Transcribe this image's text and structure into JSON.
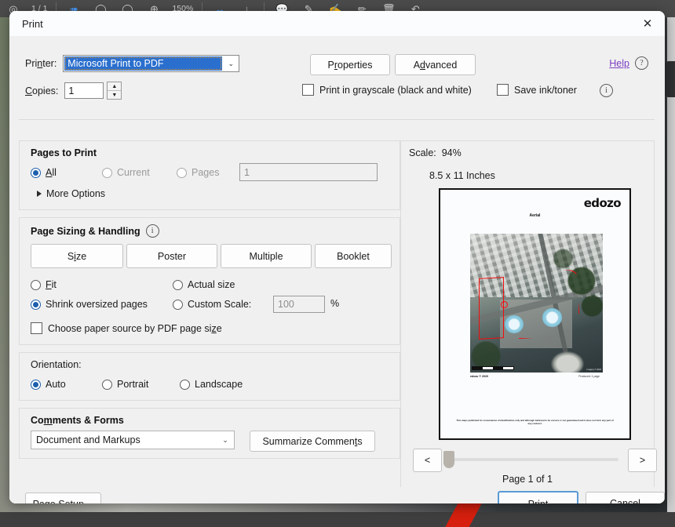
{
  "backdrop": {
    "toolbar_icons": [
      "page-down-icon",
      "page-number-icon",
      "select-tool-icon",
      "ellipse-icon",
      "ellipse-outline-icon",
      "add-circle-icon",
      "fit-width-icon",
      "download-icon",
      "comment-icon",
      "highlight-icon",
      "signature-icon",
      "edit-icon",
      "trash-icon",
      "undo-icon"
    ],
    "zoom_level": "150%"
  },
  "dialog": {
    "title": "Print",
    "close_label": "✕"
  },
  "printer": {
    "label": "Printer:",
    "value": "Microsoft Print to PDF",
    "caret": "⌄",
    "properties_label": "Properties",
    "advanced_label": "Advanced",
    "help_label": "Help",
    "help_info_icon": "i",
    "copies_label": "Copies:",
    "copies_value": "1",
    "spin_up": "▲",
    "spin_down": "▼",
    "grayscale_label": "Print in grayscale (black and white)",
    "grayscale_checked": false,
    "save_ink_label": "Save ink/toner",
    "save_ink_checked": false,
    "save_ink_info_icon": "i"
  },
  "pages_to_print": {
    "title": "Pages to Print",
    "options": [
      {
        "label": "All",
        "selected": true,
        "disabled": false
      },
      {
        "label": "Current",
        "selected": false,
        "disabled": true
      },
      {
        "label": "Pages",
        "selected": false,
        "disabled": true
      }
    ],
    "pages_input_value": "1",
    "more_options_label": "More Options"
  },
  "page_sizing": {
    "title": "Page Sizing & Handling",
    "info_icon": "i",
    "tabs": [
      {
        "label": "Size",
        "active": true
      },
      {
        "label": "Poster",
        "active": false
      },
      {
        "label": "Multiple",
        "active": false
      },
      {
        "label": "Booklet",
        "active": false
      }
    ],
    "fit_label": "Fit",
    "actual_size_label": "Actual size",
    "shrink_label": "Shrink oversized pages",
    "custom_scale_label": "Custom Scale:",
    "custom_scale_value": "100",
    "percent_symbol": "%",
    "selected_option": "Shrink oversized pages",
    "paper_source_label": "Choose paper source by PDF page size",
    "paper_source_checked": false
  },
  "orientation": {
    "label": "Orientation:",
    "options": [
      {
        "label": "Auto",
        "selected": true
      },
      {
        "label": "Portrait",
        "selected": false
      },
      {
        "label": "Landscape",
        "selected": false
      }
    ]
  },
  "comments_forms": {
    "title": "Comments & Forms",
    "select_value": "Document and Markups",
    "caret": "⌄",
    "summarize_label": "Summarize Comments"
  },
  "preview": {
    "scale_label": "Scale:",
    "scale_value": "94%",
    "paper_size": "8.5 x 11 Inches",
    "page_indicator": "Page 1 of 1",
    "prev_label": "<",
    "next_label": ">",
    "document": {
      "logo": "edozo",
      "map_title": "Aerial",
      "credit": "edozo © 2020",
      "credit_right": "Produced: 1 page",
      "attribution": "Imagery © 2020",
      "disclaimer": "This maps published for convenience of identification only and although believed to be correct, is not guaranteed and it does not form any part of any contract."
    }
  },
  "footer": {
    "page_setup_label": "Page Setup…",
    "print_label": "Print",
    "cancel_label": "Cancel"
  },
  "colors": {
    "accent_blue": "#1c5fad",
    "selection_blue": "#2a6fce",
    "help_link": "#7d3fc4",
    "boundary_red": "#f20c0c",
    "dialog_bg": "#f0f0f0"
  }
}
